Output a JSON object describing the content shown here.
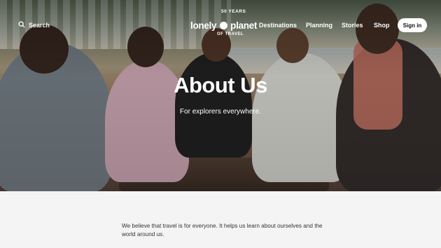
{
  "nav": {
    "search_label": "Search",
    "logo": {
      "years": "50 YEARS",
      "word_left": "lonely",
      "word_right": "planet",
      "travel": "OF TRAVEL"
    },
    "menu": [
      "Destinations",
      "Planning",
      "Stories",
      "Shop"
    ],
    "signin_label": "Sign in"
  },
  "hero": {
    "title": "About Us",
    "subtitle": "For explorers everywhere."
  },
  "body": {
    "paragraph": "We believe that travel is for everyone. It helps us learn about ourselves and the world around us."
  }
}
